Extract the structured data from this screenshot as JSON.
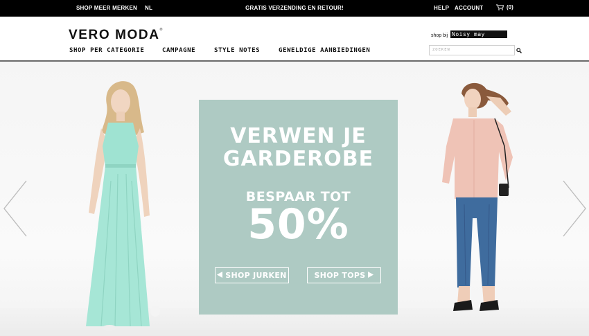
{
  "topbar": {
    "shop_more_brands": "SHOP MEER MERKEN",
    "language": "NL",
    "promo_message": "GRATIS VERZENDING EN RETOUR!",
    "help": "HELP",
    "account": "ACCOUNT",
    "cart_count": "(0)",
    "cart_icon": "cart-icon"
  },
  "header": {
    "logo": "VERO MODA",
    "logo_mark": "®",
    "shop_at_label": "shop bij",
    "partner_brand": "Noisy may",
    "search_placeholder": "ZOEKEN",
    "search_icon": "search-icon",
    "nav": [
      {
        "label": "SHOP PER CATEGORIE"
      },
      {
        "label": "CAMPAGNE"
      },
      {
        "label": "STYLE NOTES"
      },
      {
        "label": "GEWELDIGE AANBIEDINGEN"
      }
    ]
  },
  "hero": {
    "headline_line1": "VERWEN JE",
    "headline_line2": "GARDEROBE",
    "save_label": "BESPAAR TOT",
    "discount": "50%",
    "button_left": "SHOP JURKEN",
    "button_right": "SHOP TOPS",
    "colors": {
      "promo_bg": "#aecac3",
      "dress": "#9fe3d2",
      "blouse": "#efc3b6",
      "jeans": "#3f6c9e"
    },
    "prev_icon": "chevron-left-icon",
    "next_icon": "chevron-right-icon"
  }
}
